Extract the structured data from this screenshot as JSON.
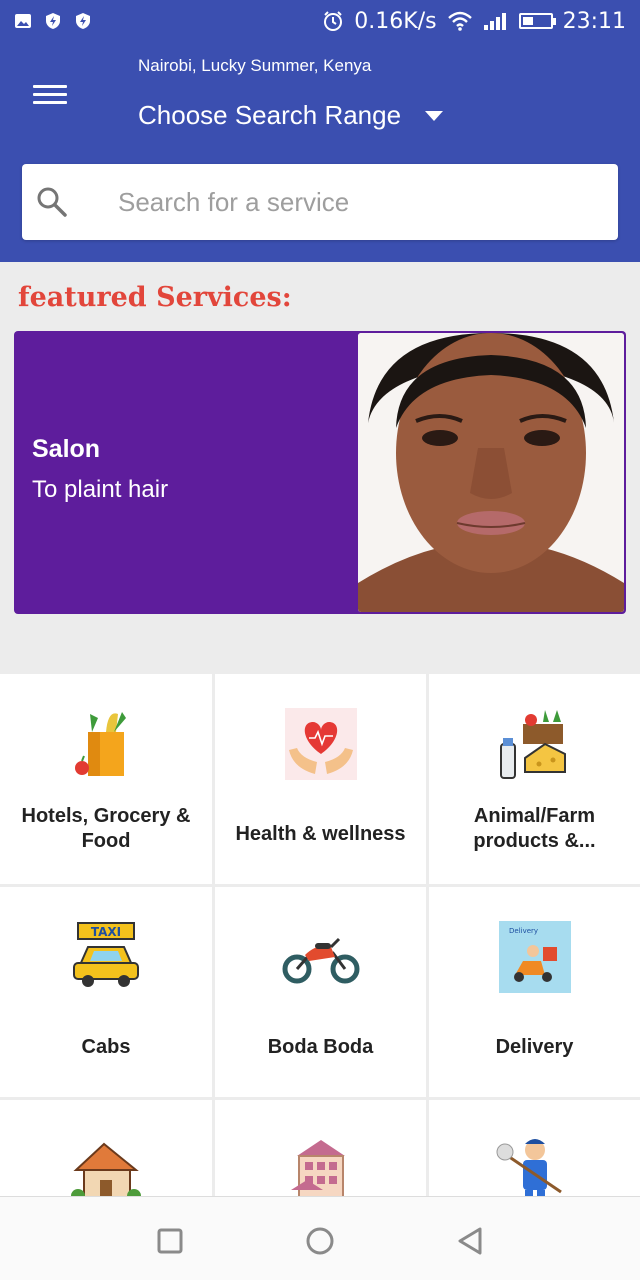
{
  "status_bar": {
    "left_icons": [
      "image-icon",
      "shield-icon",
      "shield-icon"
    ],
    "speed": "0.16K/s",
    "time": "23:11",
    "right_icons": [
      "alarm-icon",
      "wifi-icon",
      "signal-icon",
      "battery-icon"
    ]
  },
  "header": {
    "location": "Nairobi, Lucky Summer, Kenya",
    "range_label": "Choose Search Range",
    "search_placeholder": "Search for a service",
    "color": "#3b4fb0"
  },
  "featured": {
    "title": "featured Services:",
    "banner": {
      "title": "Salon",
      "subtitle": "To plaint hair",
      "color": "#5e1d9c"
    }
  },
  "categories": [
    {
      "label": "Hotels, Grocery & Food",
      "icon": "grocery-bag-icon"
    },
    {
      "label": "Health & wellness",
      "icon": "heart-hands-icon"
    },
    {
      "label": "Animal/Farm products &...",
      "icon": "farm-products-icon"
    },
    {
      "label": "Cabs",
      "icon": "taxi-icon"
    },
    {
      "label": "Boda Boda",
      "icon": "motorcycle-icon"
    },
    {
      "label": "Delivery",
      "icon": "delivery-icon"
    },
    {
      "label": "",
      "icon": "house-icon"
    },
    {
      "label": "",
      "icon": "building-icon"
    },
    {
      "label": "",
      "icon": "cleaner-icon"
    }
  ],
  "nav": [
    "recent-apps-icon",
    "home-icon",
    "back-icon"
  ]
}
